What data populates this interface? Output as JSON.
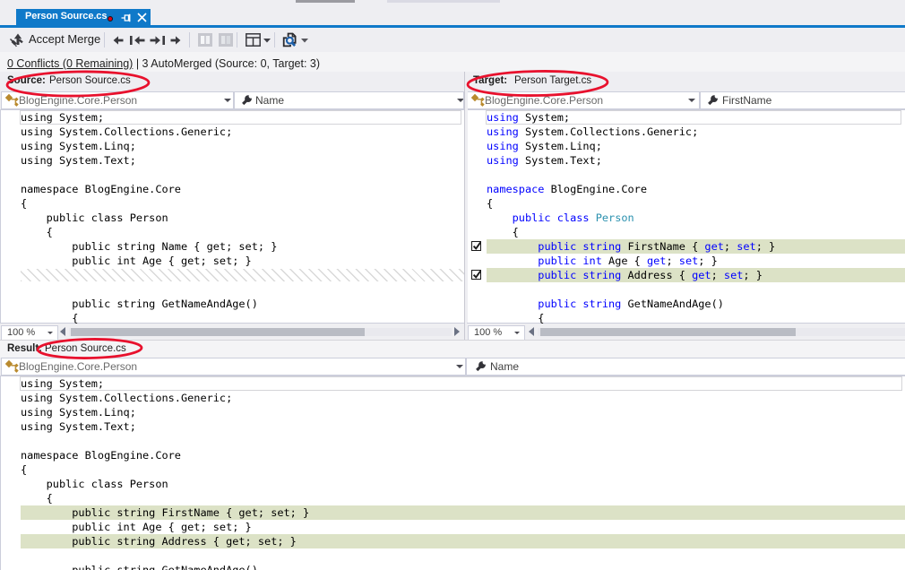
{
  "tab": {
    "title": "Person Source.cs"
  },
  "toolbar": {
    "accept_merge_label": "Accept Merge",
    "icons": [
      "accept-merge-icon",
      "prev-change-icon",
      "first-change-icon",
      "last-change-icon",
      "next-change-icon",
      "two-pane-left-icon",
      "two-pane-right-icon",
      "layout-grid-icon",
      "compare-files-icon"
    ]
  },
  "status": {
    "conflicts_link": "0 Conflicts (0 Remaining)",
    "separator": " | ",
    "automerged": "3 AutoMerged (Source: 0, Target: 3)"
  },
  "panes": {
    "source": {
      "label": "Source:",
      "file": "Person Source.cs",
      "type_dropdown": "BlogEngine.Core.Person",
      "member_dropdown": "Name",
      "zoom": "100 %"
    },
    "target": {
      "label": "Target:",
      "file": "Person Target.cs",
      "type_dropdown": "BlogEngine.Core.Person",
      "member_dropdown": "FirstName",
      "zoom": "100 %"
    },
    "result": {
      "label": "Result:",
      "file": "Person Source.cs",
      "type_dropdown": "BlogEngine.Core.Person",
      "member_dropdown": "Name"
    }
  },
  "code": {
    "source_lines": [
      {
        "t": "using System;",
        "cur": true
      },
      {
        "t": "using System.Collections.Generic;"
      },
      {
        "t": "using System.Linq;"
      },
      {
        "t": "using System.Text;"
      },
      {
        "t": ""
      },
      {
        "t": "namespace BlogEngine.Core"
      },
      {
        "t": "{"
      },
      {
        "t": "    public class Person"
      },
      {
        "t": "    {"
      },
      {
        "t": "        public string Name { get; set; }"
      },
      {
        "t": "        public int Age { get; set; }"
      },
      {
        "hatch": true
      },
      {
        "t": ""
      },
      {
        "t": "        public string GetNameAndAge()"
      },
      {
        "t": "        {"
      }
    ],
    "target_lines": [
      {
        "seg": [
          [
            "using",
            "k"
          ],
          [
            " System;",
            "p"
          ]
        ],
        "cur": true
      },
      {
        "seg": [
          [
            "using",
            "k"
          ],
          [
            " System.Collections.Generic;",
            "p"
          ]
        ]
      },
      {
        "seg": [
          [
            "using",
            "k"
          ],
          [
            " System.Linq;",
            "p"
          ]
        ]
      },
      {
        "seg": [
          [
            "using",
            "k"
          ],
          [
            " System.Text;",
            "p"
          ]
        ]
      },
      {
        "seg": []
      },
      {
        "seg": [
          [
            "namespace",
            "k"
          ],
          [
            " BlogEngine.Core",
            "p"
          ]
        ]
      },
      {
        "seg": [
          [
            "{",
            "p"
          ]
        ]
      },
      {
        "seg": [
          [
            "    ",
            "p"
          ],
          [
            "public class ",
            "k"
          ],
          [
            "Person",
            "t"
          ]
        ]
      },
      {
        "seg": [
          [
            "    {",
            "p"
          ]
        ]
      },
      {
        "seg": [
          [
            "        ",
            "p"
          ],
          [
            "public string ",
            "k"
          ],
          [
            "FirstName { ",
            "p"
          ],
          [
            "get",
            "k"
          ],
          [
            "; ",
            "p"
          ],
          [
            "set",
            "k"
          ],
          [
            "; }",
            "p"
          ]
        ],
        "merged": true,
        "check": true
      },
      {
        "seg": [
          [
            "        ",
            "p"
          ],
          [
            "public int ",
            "k"
          ],
          [
            "Age { ",
            "p"
          ],
          [
            "get",
            "k"
          ],
          [
            "; ",
            "p"
          ],
          [
            "set",
            "k"
          ],
          [
            "; }",
            "p"
          ]
        ]
      },
      {
        "seg": [
          [
            "        ",
            "p"
          ],
          [
            "public string ",
            "k"
          ],
          [
            "Address { ",
            "p"
          ],
          [
            "get",
            "k"
          ],
          [
            "; ",
            "p"
          ],
          [
            "set",
            "k"
          ],
          [
            "; }",
            "p"
          ]
        ],
        "merged": true,
        "check": true
      },
      {
        "seg": []
      },
      {
        "seg": [
          [
            "        ",
            "p"
          ],
          [
            "public string ",
            "k"
          ],
          [
            "GetNameAndAge()",
            "p"
          ]
        ]
      },
      {
        "seg": [
          [
            "        {",
            "p"
          ]
        ]
      }
    ],
    "result_lines": [
      {
        "t": "using System;",
        "cur": true
      },
      {
        "t": "using System.Collections.Generic;"
      },
      {
        "t": "using System.Linq;"
      },
      {
        "t": "using System.Text;"
      },
      {
        "t": ""
      },
      {
        "t": "namespace BlogEngine.Core"
      },
      {
        "t": "{"
      },
      {
        "t": "    public class Person"
      },
      {
        "t": "    {"
      },
      {
        "t": "        public string FirstName { get; set; }",
        "merged": true
      },
      {
        "t": "        public int Age { get; set; }"
      },
      {
        "t": "        public string Address { get; set; }",
        "merged": true
      },
      {
        "t": ""
      },
      {
        "t": "        public string GetNameAndAge()"
      }
    ]
  },
  "colors": {
    "accent_blue": "#0f79c9",
    "keyword_blue": "#0000ff",
    "type_teal": "#2b91af",
    "merge_highlight_green": "#dce2c6",
    "annotation_red": "#e8112d",
    "modified_dot_red": "#e00016"
  }
}
